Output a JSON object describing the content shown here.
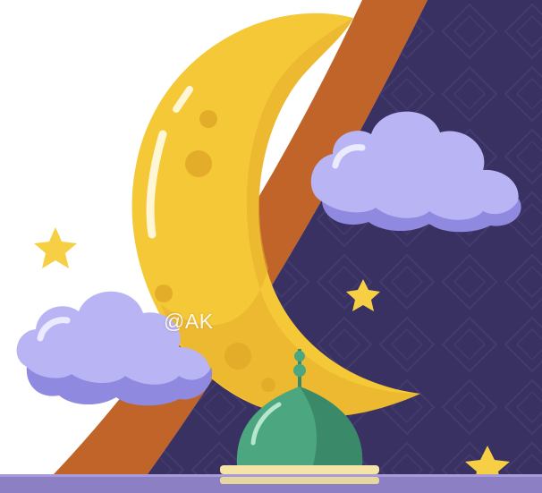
{
  "watermark": {
    "text": "@AK"
  },
  "palette": {
    "night_sky": "#3a3163",
    "band": "#c0642a",
    "moon": "#f5c838",
    "moon_shade": "#e3ad2a",
    "cloud": "#b9b5f5",
    "cloud_shade": "#8f8ae0",
    "star": "#f7cf45",
    "dome": "#4ca67f",
    "dome_dark": "#3a8a69",
    "bottom_strip": "#8c7fc4"
  },
  "elements": [
    "crescent-moon",
    "cloud-right",
    "cloud-left",
    "star-left",
    "star-middle",
    "star-bottom-right",
    "mosque-dome",
    "night-sky",
    "orange-band"
  ]
}
